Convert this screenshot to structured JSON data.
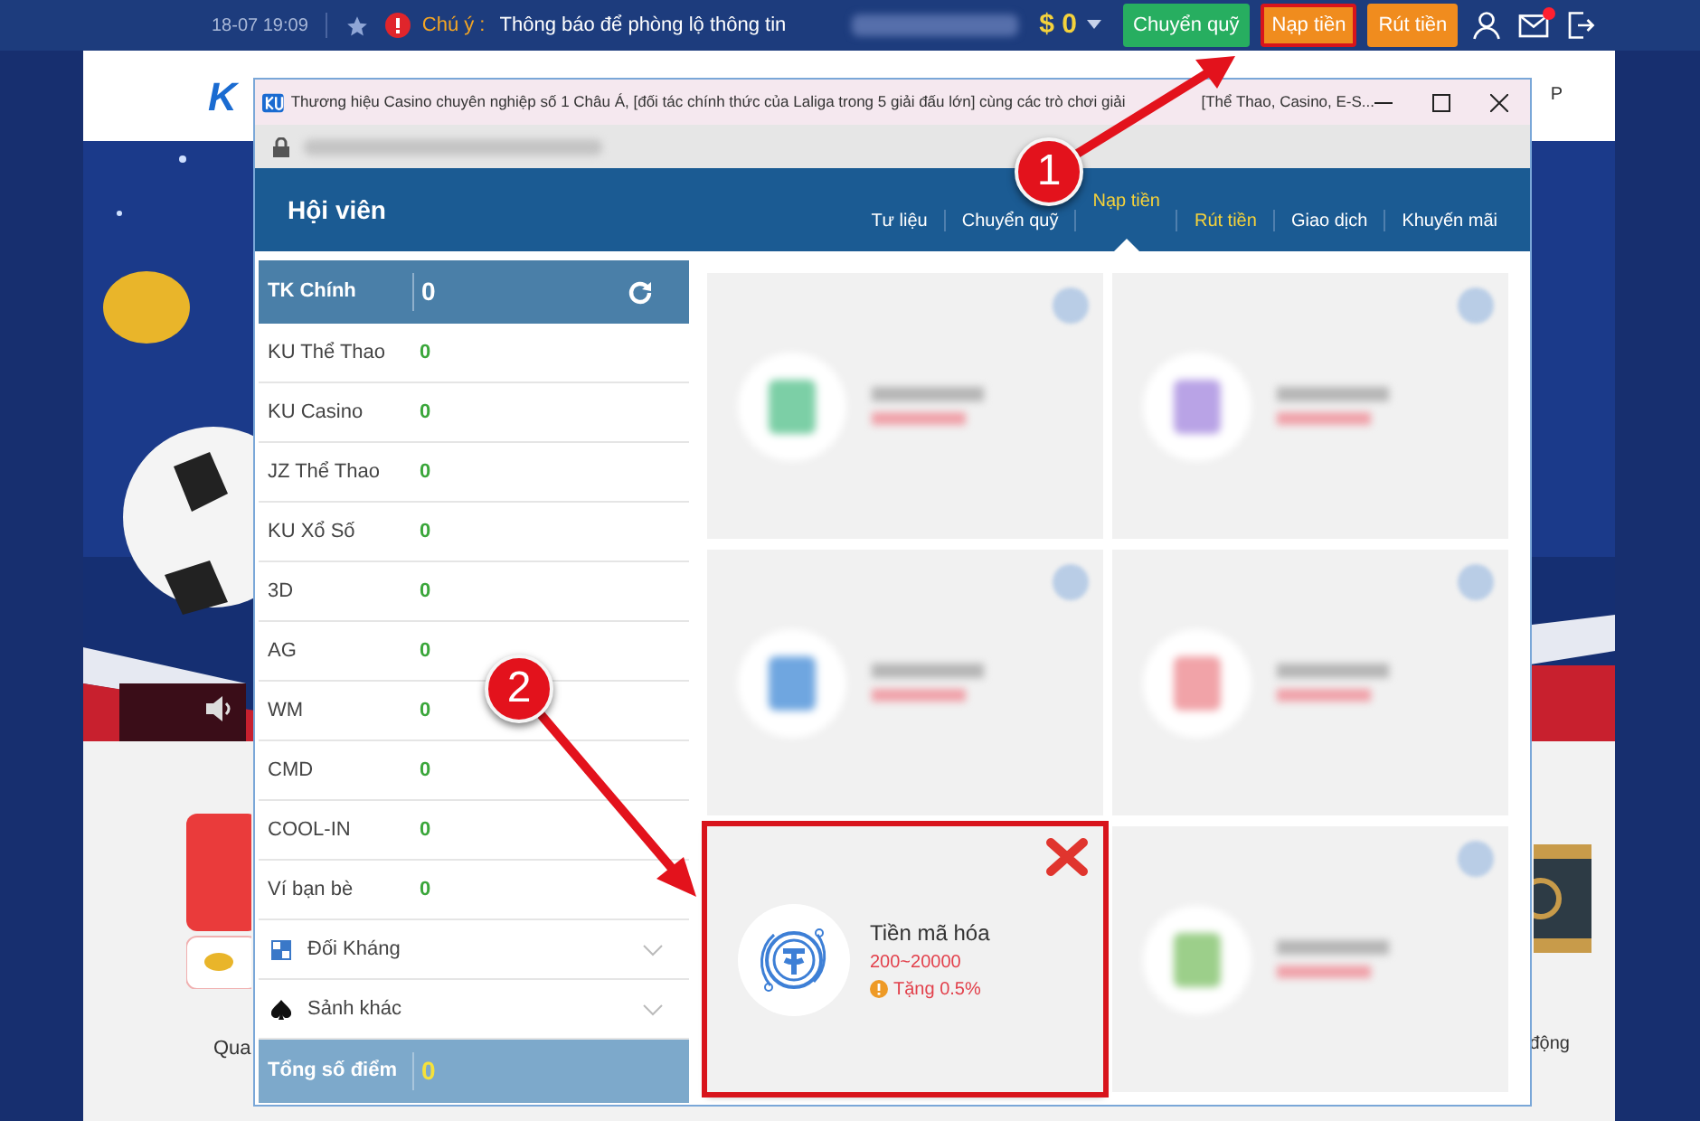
{
  "top_bar": {
    "datetime": "18-07 19:09",
    "notice_label": "Chú ý :",
    "notice": "Thông báo để phòng lộ thông tin",
    "balance": "$ 0",
    "buttons": [
      {
        "label": "Chuyển quỹ",
        "kind": "green",
        "highlighted": false
      },
      {
        "label": "Nạp tiền",
        "kind": "orange",
        "highlighted": true
      },
      {
        "label": "Rút tiền",
        "kind": "orange",
        "highlighted": false
      }
    ],
    "mail_unread": true
  },
  "site_header": {
    "logo": "K",
    "right_text": "P"
  },
  "lower_section": {
    "captions": [
      "Qua",
      "động"
    ]
  },
  "popup": {
    "title_parts": [
      "Thương hiệu Casino chuyên nghiệp số 1 Châu Á, [đối tác chính thức của Laliga trong 5 giải đấu lớn] cùng các trò chơi giải",
      "[Thể Thao, Casino, E-S..."
    ],
    "nav_title": "Hội viên",
    "tabs": [
      {
        "label": "Tư liệu",
        "selected": false,
        "highlighted": false
      },
      {
        "label": "Chuyển quỹ",
        "selected": false,
        "highlighted": false
      },
      {
        "label": "Nạp tiền",
        "selected": true,
        "highlighted": true
      },
      {
        "label": "Rút tiền",
        "selected": false,
        "highlighted": true
      },
      {
        "label": "Giao dịch",
        "selected": false,
        "highlighted": false
      },
      {
        "label": "Khuyến mãi",
        "selected": false,
        "highlighted": false
      }
    ],
    "wallet": {
      "header": {
        "label": "TK Chính",
        "value": "0"
      },
      "rows": [
        {
          "name": "KU Thể Thao",
          "value": "0"
        },
        {
          "name": "KU Casino",
          "value": "0"
        },
        {
          "name": "JZ Thể Thao",
          "value": "0"
        },
        {
          "name": "KU Xổ Số",
          "value": "0"
        },
        {
          "name": "3D",
          "value": "0"
        },
        {
          "name": "AG",
          "value": "0"
        },
        {
          "name": "WM",
          "value": "0"
        },
        {
          "name": "CMD",
          "value": "0"
        },
        {
          "name": "COOL-IN",
          "value": "0"
        },
        {
          "name": "Ví bạn bè",
          "value": "0"
        }
      ],
      "groups": [
        {
          "label": "Đối Kháng",
          "kind": "grid",
          "expanded": false
        },
        {
          "label": "Sảnh khác",
          "kind": "spade",
          "expanded": false
        }
      ],
      "total": {
        "label": "Tổng số điểm",
        "value": "0"
      }
    },
    "methods": [
      {
        "kind": "blurred",
        "color": "#7ccfa6"
      },
      {
        "kind": "blurred",
        "color": "#b9a3e6"
      },
      {
        "kind": "blurred",
        "color": "#6fa6e0"
      },
      {
        "kind": "blurred",
        "color": "#f1a3a8"
      },
      {
        "kind": "method",
        "title": "Tiền mã hóa",
        "range": "200~20000",
        "bonus": "Tặng 0.5%",
        "highlighted": true
      },
      {
        "kind": "blurred",
        "color": "#9ccf8a"
      }
    ]
  },
  "annotations": [
    {
      "number": "1"
    },
    {
      "number": "2"
    }
  ]
}
